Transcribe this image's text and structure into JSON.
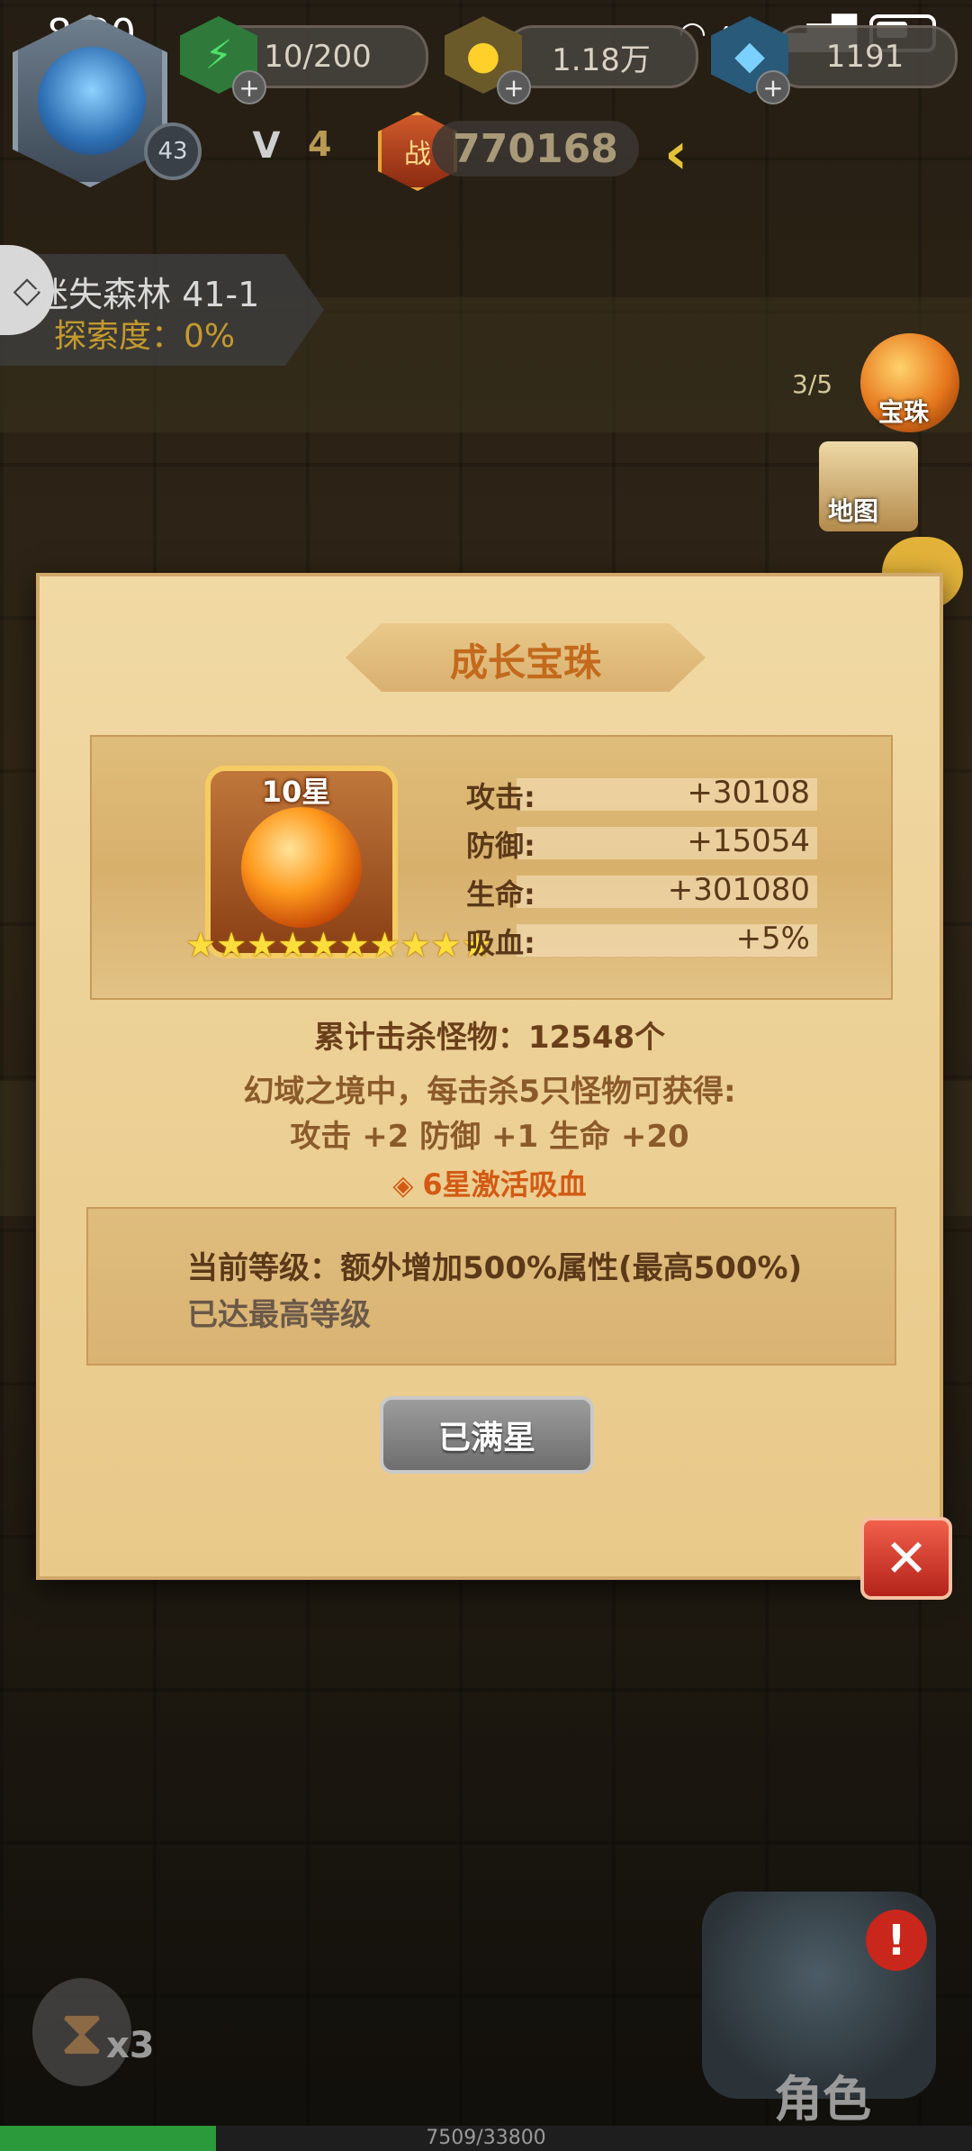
{
  "status_bar": {
    "time": "8:30",
    "network": "4G"
  },
  "hud": {
    "player_level": "43",
    "stamina": "10/200",
    "gold": "1.18万",
    "gems": "1191",
    "vip_level": "4",
    "vip_letter": "V",
    "power_icon_text": "战",
    "power": "770168"
  },
  "stage": {
    "name": "迷失森林 41-1",
    "progress": "探索度：0%"
  },
  "side_buttons": {
    "orb": "宝珠",
    "map": "地图",
    "wave": "3/5"
  },
  "dialog": {
    "title": "成长宝珠",
    "orb": {
      "stars_label": "10星",
      "star_count": 10
    },
    "stats": [
      {
        "name": "攻击:",
        "value": "+30108"
      },
      {
        "name": "防御:",
        "value": "+15054"
      },
      {
        "name": "生命:",
        "value": "+301080"
      },
      {
        "name": "吸血:",
        "value": "+5%"
      }
    ],
    "kill_count": "累计击杀怪物：12548个",
    "reward_desc": "幻域之境中，每击杀5只怪物可获得:",
    "reward_values": "攻击 +2  防御 +1  生命 +20",
    "activate_note": "6星激活吸血",
    "current_level": "当前等级：额外增加500%属性(最高500%)",
    "max_level_note": "已达最高等级",
    "button_label": "已满星"
  },
  "bottom": {
    "speed_multiplier": "x3",
    "role_label": "角色",
    "xp_text": "7509/33800",
    "xp_progress": 0.222
  }
}
